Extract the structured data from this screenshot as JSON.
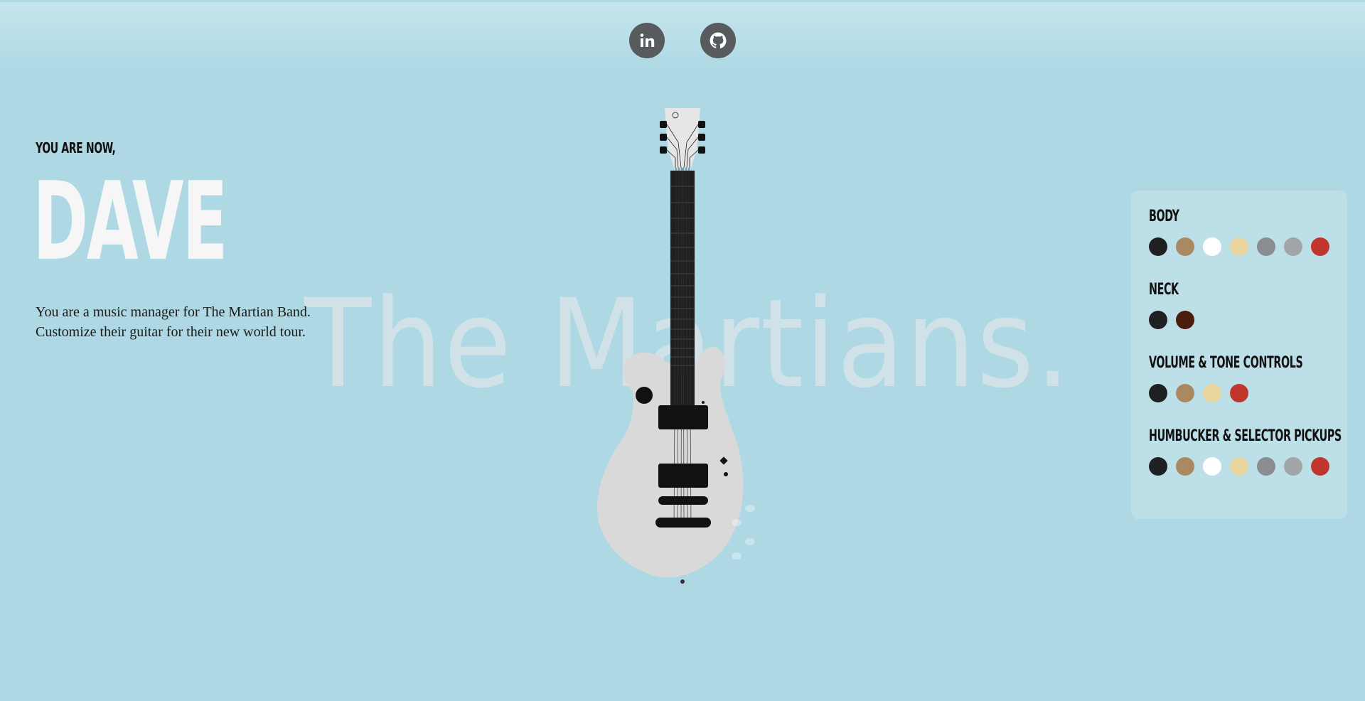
{
  "header": {
    "links": [
      {
        "id": "linkedin",
        "label": "in",
        "icon": "linkedin-icon"
      },
      {
        "id": "github",
        "icon": "github-icon"
      }
    ]
  },
  "hero": {
    "eyebrow": "YOU ARE NOW,",
    "name": "DAVE",
    "intro_line1": "You are a music manager for The Martian Band.",
    "intro_line2": "Customize their guitar for their new world tour.",
    "watermark": "The Martians."
  },
  "guitar": {
    "body_color": "#d9d9d9",
    "neck_color": "#1f1f1f",
    "hardware_color": "#111111"
  },
  "options": [
    {
      "title": "BODY",
      "colors": [
        "#1f2022",
        "#a88962",
        "#ffffff",
        "#e9d69e",
        "#8a8c8f",
        "#a2a5a8",
        "#c0362c"
      ]
    },
    {
      "title": "NECK",
      "colors": [
        "#1f2022",
        "#4a1d0c"
      ]
    },
    {
      "title": "VOLUME & TONE CONTROLS",
      "colors": [
        "#1f2022",
        "#a88962",
        "#e9d69e",
        "#c0362c"
      ]
    },
    {
      "title": "HUMBUCKER & SELECTOR PICKUPS",
      "colors": [
        "#1f2022",
        "#a88962",
        "#ffffff",
        "#e9d69e",
        "#8a8c8f",
        "#a2a5a8",
        "#c0362c"
      ]
    }
  ]
}
